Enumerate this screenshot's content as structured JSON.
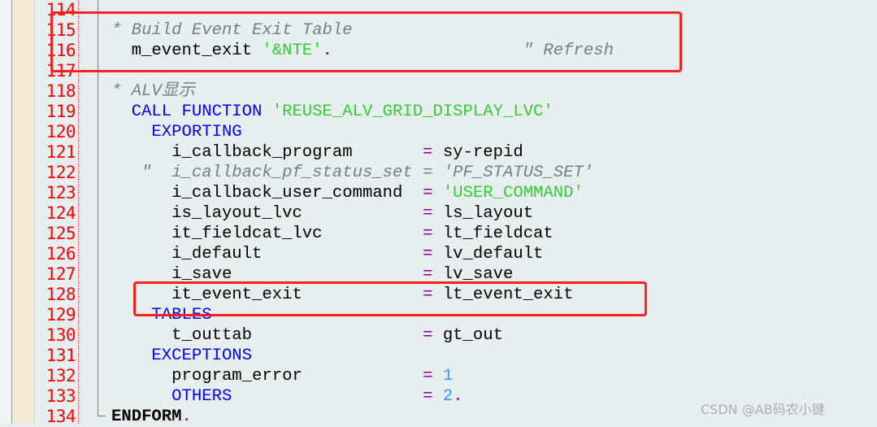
{
  "colors": {
    "keyword": "#0000ff",
    "string": "#33cc33",
    "comment": "#708088",
    "operator": "#8b008b",
    "number": "#3399ff",
    "line_number": "#ff0000",
    "highlight_box": "#ff2020"
  },
  "lines": [
    {
      "no": "114",
      "tokens": []
    },
    {
      "no": "115",
      "tokens": [
        {
          "t": "* Build Event Exit Table",
          "c": "cmt"
        }
      ]
    },
    {
      "no": "116",
      "tokens": [
        {
          "t": "  m_event_exit ",
          "c": ""
        },
        {
          "t": "'&NTE'",
          "c": "str"
        },
        {
          "t": ".",
          "c": "op"
        },
        {
          "t": "                   \" Refresh",
          "c": "cmt"
        }
      ]
    },
    {
      "no": "117",
      "tokens": []
    },
    {
      "no": "118",
      "tokens": [
        {
          "t": "* ALV显示",
          "c": "cmt"
        }
      ]
    },
    {
      "no": "119",
      "tokens": [
        {
          "t": "  CALL FUNCTION ",
          "c": "kw"
        },
        {
          "t": "'REUSE_ALV_GRID_DISPLAY_LVC'",
          "c": "str"
        }
      ]
    },
    {
      "no": "120",
      "tokens": [
        {
          "t": "    EXPORTING",
          "c": "kw"
        }
      ]
    },
    {
      "no": "121",
      "tokens": [
        {
          "t": "      i_callback_program       ",
          "c": ""
        },
        {
          "t": "=",
          "c": "op"
        },
        {
          "t": " sy-repid",
          "c": ""
        }
      ]
    },
    {
      "no": "122",
      "tokens": [
        {
          "t": "   \"  i_callback_pf_status_set = 'PF_STATUS_SET'",
          "c": "cmt"
        }
      ]
    },
    {
      "no": "123",
      "tokens": [
        {
          "t": "      i_callback_user_command  ",
          "c": ""
        },
        {
          "t": "=",
          "c": "op"
        },
        {
          "t": " 'USER_COMMAND'",
          "c": "str"
        }
      ]
    },
    {
      "no": "124",
      "tokens": [
        {
          "t": "      is_layout_lvc            ",
          "c": ""
        },
        {
          "t": "=",
          "c": "op"
        },
        {
          "t": " ls_layout",
          "c": ""
        }
      ]
    },
    {
      "no": "125",
      "tokens": [
        {
          "t": "      it_fieldcat_lvc          ",
          "c": ""
        },
        {
          "t": "=",
          "c": "op"
        },
        {
          "t": " lt_fieldcat",
          "c": ""
        }
      ]
    },
    {
      "no": "126",
      "tokens": [
        {
          "t": "      i_default                ",
          "c": ""
        },
        {
          "t": "=",
          "c": "op"
        },
        {
          "t": " lv_default",
          "c": ""
        }
      ]
    },
    {
      "no": "127",
      "tokens": [
        {
          "t": "      i_save                   ",
          "c": ""
        },
        {
          "t": "=",
          "c": "op"
        },
        {
          "t": " lv_save",
          "c": ""
        }
      ]
    },
    {
      "no": "128",
      "tokens": [
        {
          "t": "      it_event_exit            ",
          "c": ""
        },
        {
          "t": "=",
          "c": "op"
        },
        {
          "t": " lt_event_exit",
          "c": ""
        }
      ]
    },
    {
      "no": "129",
      "tokens": [
        {
          "t": "    TABLES",
          "c": "kw"
        }
      ]
    },
    {
      "no": "130",
      "tokens": [
        {
          "t": "      t_outtab                 ",
          "c": ""
        },
        {
          "t": "=",
          "c": "op"
        },
        {
          "t": " gt_out",
          "c": ""
        }
      ]
    },
    {
      "no": "131",
      "tokens": [
        {
          "t": "    EXCEPTIONS",
          "c": "kw"
        }
      ]
    },
    {
      "no": "132",
      "tokens": [
        {
          "t": "      program_error            ",
          "c": ""
        },
        {
          "t": "=",
          "c": "op"
        },
        {
          "t": " 1",
          "c": "num"
        }
      ]
    },
    {
      "no": "133",
      "tokens": [
        {
          "t": "      OTHERS",
          "c": "kw"
        },
        {
          "t": "                   ",
          "c": ""
        },
        {
          "t": "=",
          "c": "op"
        },
        {
          "t": " 2",
          "c": "num"
        },
        {
          "t": ".",
          "c": "op"
        }
      ]
    },
    {
      "no": "134",
      "tokens": [
        {
          "t": "ENDFORM",
          "c": "bold"
        },
        {
          "t": ".",
          "c": "op"
        }
      ]
    }
  ],
  "watermark": "CSDN @AB码农小键"
}
